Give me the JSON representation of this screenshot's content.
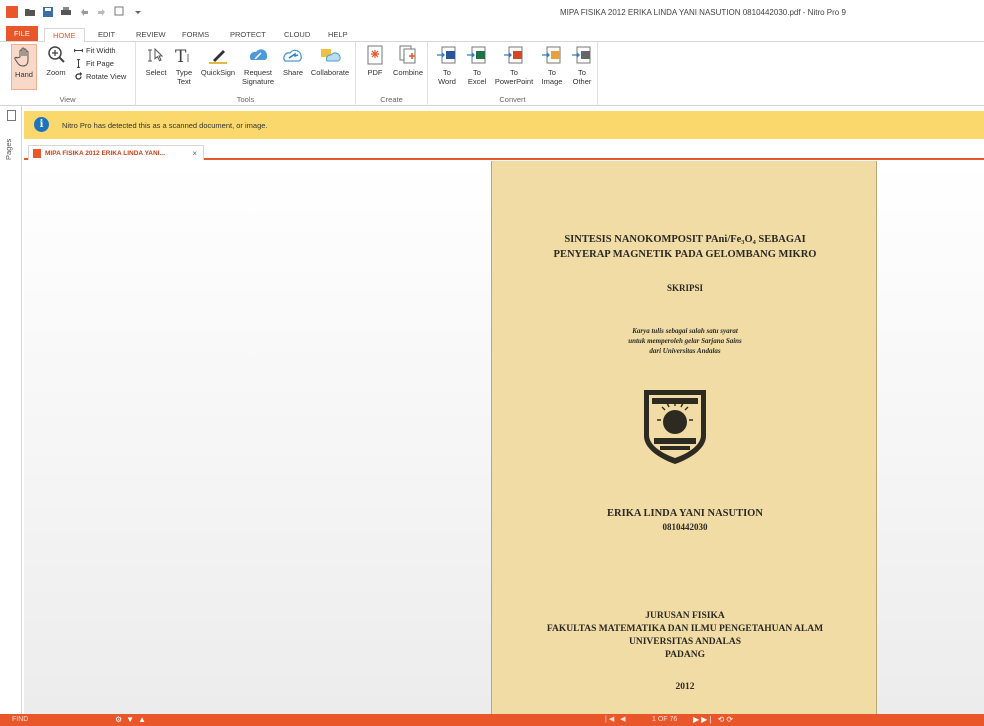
{
  "window": {
    "title": "MIPA FISIKA 2012 ERIKA LINDA YANI NASUTION 0810442030.pdf - Nitro Pro 9"
  },
  "ribbon_tabs": [
    "FILE",
    "HOME",
    "EDIT",
    "REVIEW",
    "FORMS",
    "PROTECT",
    "CLOUD",
    "HELP"
  ],
  "active_tab": "HOME",
  "groups": {
    "view": {
      "label": "View",
      "hand": "Hand",
      "zoom": "Zoom",
      "fit_width": "Fit Width",
      "fit_page": "Fit Page",
      "rotate_view": "Rotate View"
    },
    "tools": {
      "label": "Tools",
      "select": "Select",
      "type_text_1": "Type",
      "type_text_2": "Text",
      "quicksign": "QuickSign",
      "request_1": "Request",
      "request_2": "Signature",
      "share": "Share",
      "collaborate": "Collaborate"
    },
    "create": {
      "label": "Create",
      "pdf": "PDF",
      "combine": "Combine"
    },
    "convert": {
      "label": "Convert",
      "to": "To",
      "word": "Word",
      "excel": "Excel",
      "powerpoint": "PowerPoint",
      "image": "Image",
      "other": "Other"
    }
  },
  "notice": {
    "message": "Nitro Pro has detected this as a scanned document, or image."
  },
  "left_pane": {
    "pages_label": "Pages"
  },
  "document_tab": {
    "name": "MIPA FISIKA 2012 ERIKA LINDA YANI...",
    "close": "×"
  },
  "document": {
    "title_line1": "SINTESIS NANOKOMPOSIT PAni/Fe₃O₄ SEBAGAI",
    "title_line2": "PENYERAP MAGNETIK PADA GELOMBANG MIKRO",
    "type": "SKRIPSI",
    "purpose_line1": "Karya tulis sebagai salah satu syarat",
    "purpose_line2": "untuk memperoleh gelar Sarjana Sains",
    "purpose_line3": "dari Universitas Andalas",
    "author": "ERIKA LINDA YANI NASUTION",
    "student_id": "0810442030",
    "dept_line1": "JURUSAN FISIKA",
    "dept_line2": "FAKULTAS MATEMATIKA DAN ILMU PENGETAHUAN ALAM",
    "dept_line3": "UNIVERSITAS ANDALAS",
    "dept_line4": "PADANG",
    "year": "2012"
  },
  "status_bar": {
    "find": "FIND",
    "page_indicator": "1 OF 76"
  },
  "colors": {
    "accent": "#e8562a",
    "notice_bg": "#fbd86b",
    "page_paper": "#f1dca6"
  }
}
